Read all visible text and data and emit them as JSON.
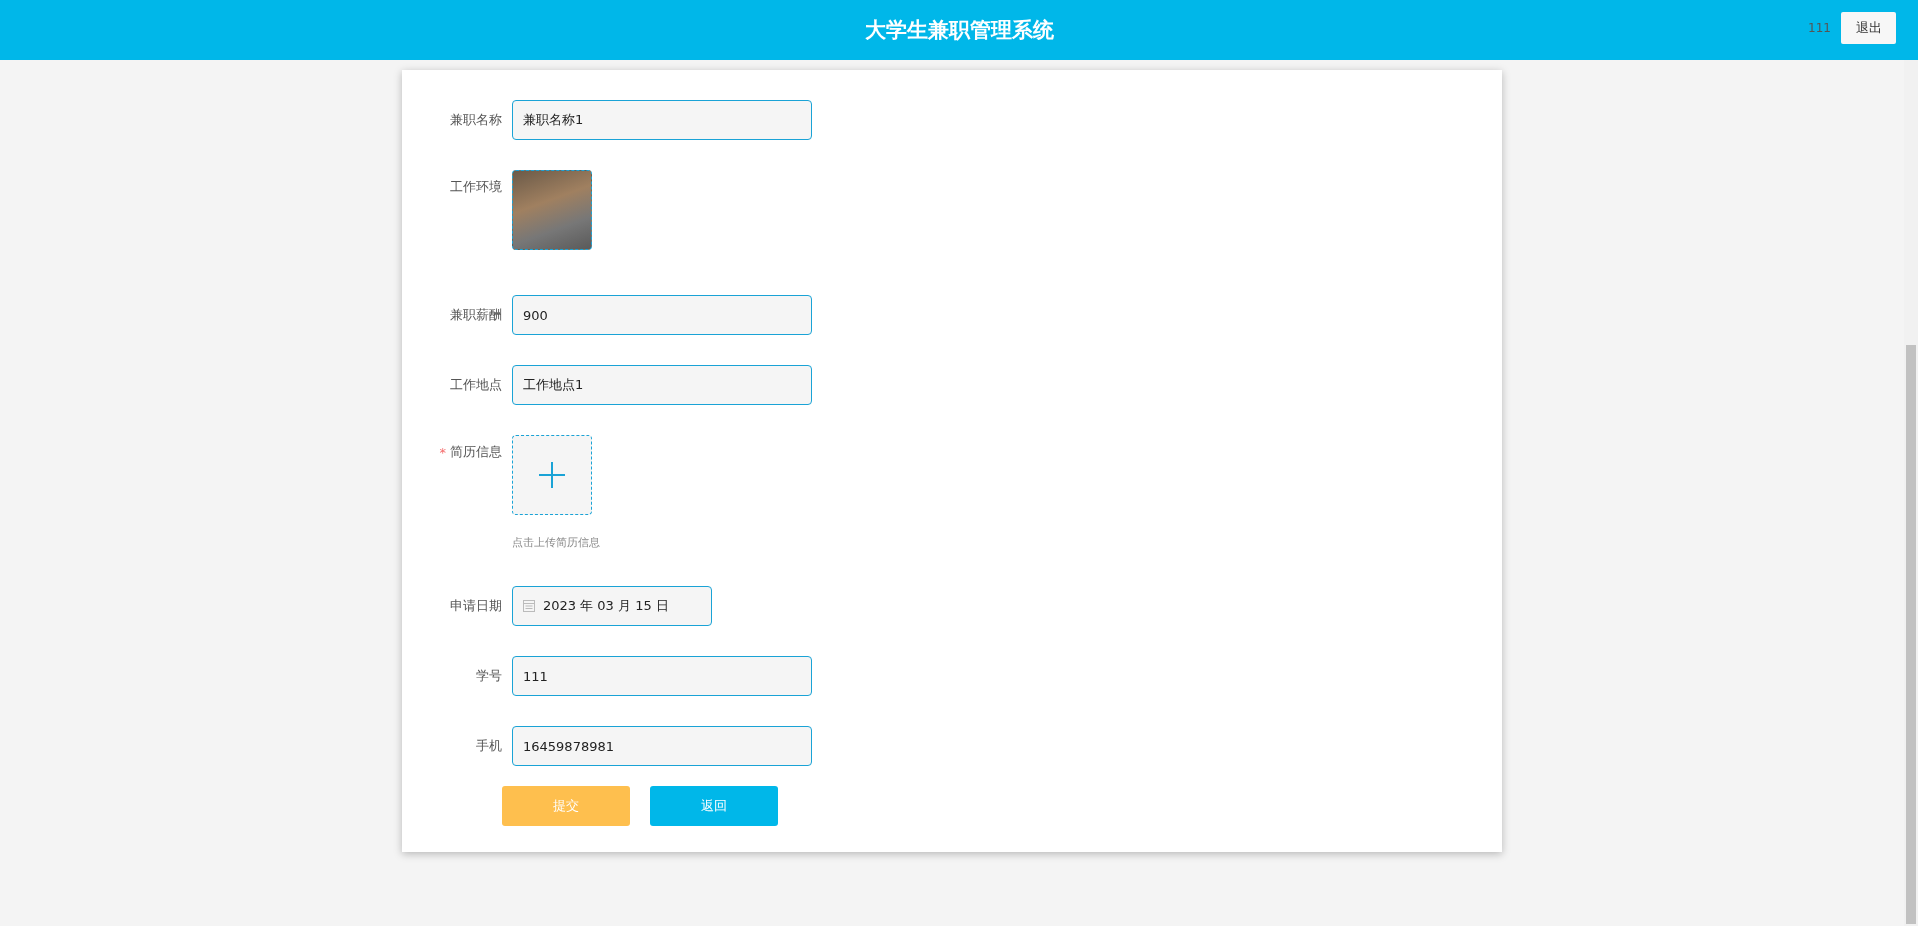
{
  "header": {
    "title": "大学生兼职管理系统",
    "username": "111",
    "logout_button": "退出"
  },
  "form": {
    "fields": [
      {
        "kind": "text",
        "label": "兼职名称",
        "value": "兼职名称1"
      },
      {
        "kind": "image",
        "label": "工作环境"
      },
      {
        "kind": "text",
        "label": "兼职薪酬",
        "value": "900"
      },
      {
        "kind": "text",
        "label": "工作地点",
        "value": "工作地点1"
      },
      {
        "kind": "upload",
        "label": "简历信息",
        "required_mark": "*",
        "hint": "点击上传简历信息"
      },
      {
        "kind": "date",
        "label": "申请日期",
        "value": "2023 年 03 月 15 日"
      },
      {
        "kind": "text",
        "label": "学号",
        "value": "111"
      },
      {
        "kind": "text",
        "label": "手机",
        "value": "16459878981"
      }
    ],
    "buttons": [
      {
        "kind": "submit",
        "label": "提交"
      },
      {
        "kind": "back",
        "label": "返回"
      }
    ]
  }
}
